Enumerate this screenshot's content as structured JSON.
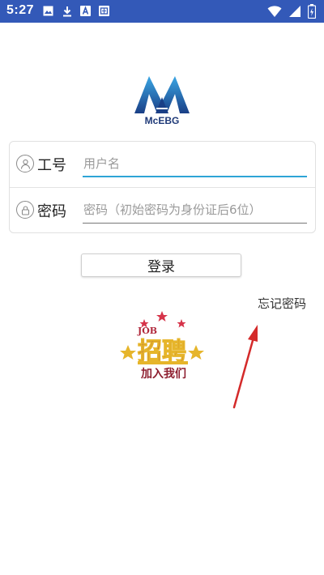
{
  "status_bar": {
    "time": "5:27",
    "notification_icons": [
      "image-icon",
      "download-icon",
      "text-icon",
      "sim-icon"
    ],
    "right_icons": [
      "wifi-icon",
      "signal-icon",
      "battery-icon"
    ]
  },
  "app": {
    "logo_text": "McEBG"
  },
  "login_form": {
    "user_label": "工号",
    "user_placeholder": "用户名",
    "password_label": "密码",
    "password_placeholder": "密码（初始密码为身份证后6位）",
    "submit_label": "登录"
  },
  "forgot_password": "忘记密码",
  "promo_image": {
    "text_main": "招聘",
    "text_sub": "加入我们",
    "text_top": "JOB"
  },
  "colors": {
    "status_bar": "#3359b8",
    "input_focus": "#2ea4d6",
    "logo_blue": "#1f3a78",
    "annotation_arrow": "#d42a2a"
  }
}
